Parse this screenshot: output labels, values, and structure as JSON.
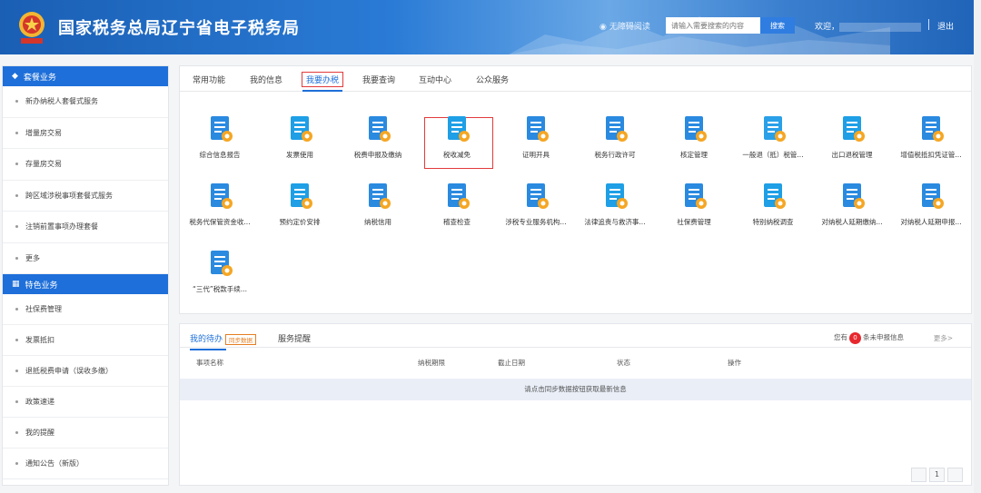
{
  "header": {
    "site_title": "国家税务总局辽宁省电子税务局",
    "accessibility_label": "无障碍阅读",
    "search_placeholder": "请输入需要搜索的内容",
    "search_button": "搜索",
    "welcome_prefix": "欢迎，",
    "logout": "退出"
  },
  "sidebar": {
    "section1_title": "套餐业务",
    "section1_items": [
      "新办纳税人套餐式服务",
      "增量房交易",
      "存量房交易",
      "跨区域涉税事项套餐式服务",
      "注销前置事项办理套餐",
      "更多"
    ],
    "section2_title": "特色业务",
    "section2_items": [
      "社保费管理",
      "发票抵扣",
      "退抵税费申请（误收多缴）",
      "政策速递",
      "我的提醒",
      "通知公告（新版）"
    ]
  },
  "tabs": [
    "常用功能",
    "我的信息",
    "我要办税",
    "我要查询",
    "互动中心",
    "公众服务"
  ],
  "active_tab": "我要办税",
  "services": [
    {
      "label": "综合信息报告",
      "icon": "report-icon",
      "color": "#2a8ae0"
    },
    {
      "label": "发票使用",
      "icon": "invoice-icon",
      "color": "#1e9fe6"
    },
    {
      "label": "税费申报及缴纳",
      "icon": "tax-declare-icon",
      "color": "#2a8ae0"
    },
    {
      "label": "税收减免",
      "icon": "tax-reduction-icon",
      "color": "#1e9fe6"
    },
    {
      "label": "证明开具",
      "icon": "certificate-icon",
      "color": "#2a8ae0"
    },
    {
      "label": "税务行政许可",
      "icon": "license-icon",
      "color": "#2a8ae0"
    },
    {
      "label": "核定管理",
      "icon": "approval-icon",
      "color": "#2a8ae0"
    },
    {
      "label": "一般退（抵）税管...",
      "icon": "refund-icon",
      "color": "#2aa0e8"
    },
    {
      "label": "出口退税管理",
      "icon": "export-refund-icon",
      "color": "#1e9fe6"
    },
    {
      "label": "增值税抵扣凭证管...",
      "icon": "vat-voucher-icon",
      "color": "#2a8ae0"
    },
    {
      "label": "税务代保管资金收...",
      "icon": "custody-fund-icon",
      "color": "#2a8ae0"
    },
    {
      "label": "预约定价安排",
      "icon": "pricing-icon",
      "color": "#1e9fe6"
    },
    {
      "label": "纳税信用",
      "icon": "credit-icon",
      "color": "#2a8ae0"
    },
    {
      "label": "稽查检查",
      "icon": "inspection-icon",
      "color": "#2a8ae0"
    },
    {
      "label": "涉税专业服务机构...",
      "icon": "agency-icon",
      "color": "#2a8ae0"
    },
    {
      "label": "法律追责与救济事...",
      "icon": "legal-icon",
      "color": "#1e9fe6"
    },
    {
      "label": "社保费管理",
      "icon": "social-security-icon",
      "color": "#2a8ae0"
    },
    {
      "label": "特别纳税调查",
      "icon": "special-survey-icon",
      "color": "#1e9fe6"
    },
    {
      "label": "对纳税人延期缴纳...",
      "icon": "deferral-pay-icon",
      "color": "#2a8ae0"
    },
    {
      "label": "对纳税人延期申报...",
      "icon": "deferral-declare-icon",
      "color": "#2a8ae0"
    },
    {
      "label": "“三代”税款手续...",
      "icon": "commission-icon",
      "color": "#2a8ae0"
    }
  ],
  "todo": {
    "tab_mine": "我的待办",
    "sync_label": "同步数据",
    "tab_reminder": "服务提醒",
    "notice_prefix": "您有",
    "notice_count": "0",
    "notice_suffix": "条未申报信息",
    "more": "更多>",
    "columns": [
      "事项名称",
      "纳税期限",
      "截止日期",
      "状态",
      "操作"
    ],
    "empty_message": "请点击同步数据按钮获取最新信息",
    "page": "1"
  }
}
